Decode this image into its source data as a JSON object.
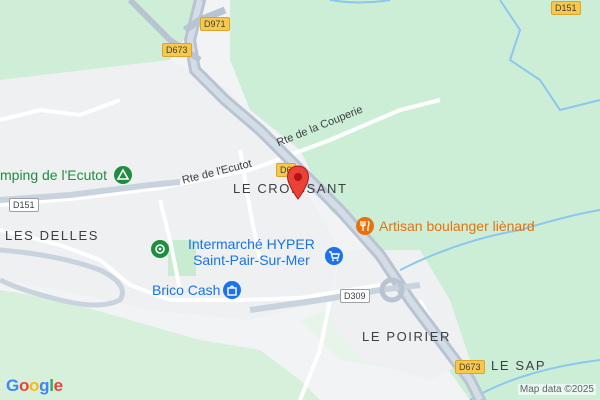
{
  "map": {
    "places": {
      "le_croissant": "LE CROISSANT",
      "les_delles": "LES DELLES",
      "le_poirier": "LE POIRIER",
      "le_sap": "LE SAP"
    },
    "pois": {
      "camping": "mping de l'Ecutot",
      "intermarche_line1": "Intermarché HYPER",
      "intermarche_line2": "Saint-Pair-Sur-Mer",
      "brico": "Brico Cash",
      "bakery": "Artisan boulanger liènard"
    },
    "roads": {
      "rte_ecutot": "Rte de l'Ecutot",
      "rte_couperie": "Rte de la Couperie"
    },
    "shields": {
      "d971": "D971",
      "d673_top": "D673",
      "d151_top": "D151",
      "d151_left": "D151",
      "d6_partial": "D6",
      "d309": "D309",
      "d673_bottom": "D673"
    },
    "attribution": "Map data ©2025",
    "logo": "Google",
    "colors": {
      "land": "#f1f3f4",
      "green": "#cdeed6",
      "water": "#8ac8ed",
      "highway": "#b8c4d2",
      "pin": "#ea4335"
    }
  }
}
